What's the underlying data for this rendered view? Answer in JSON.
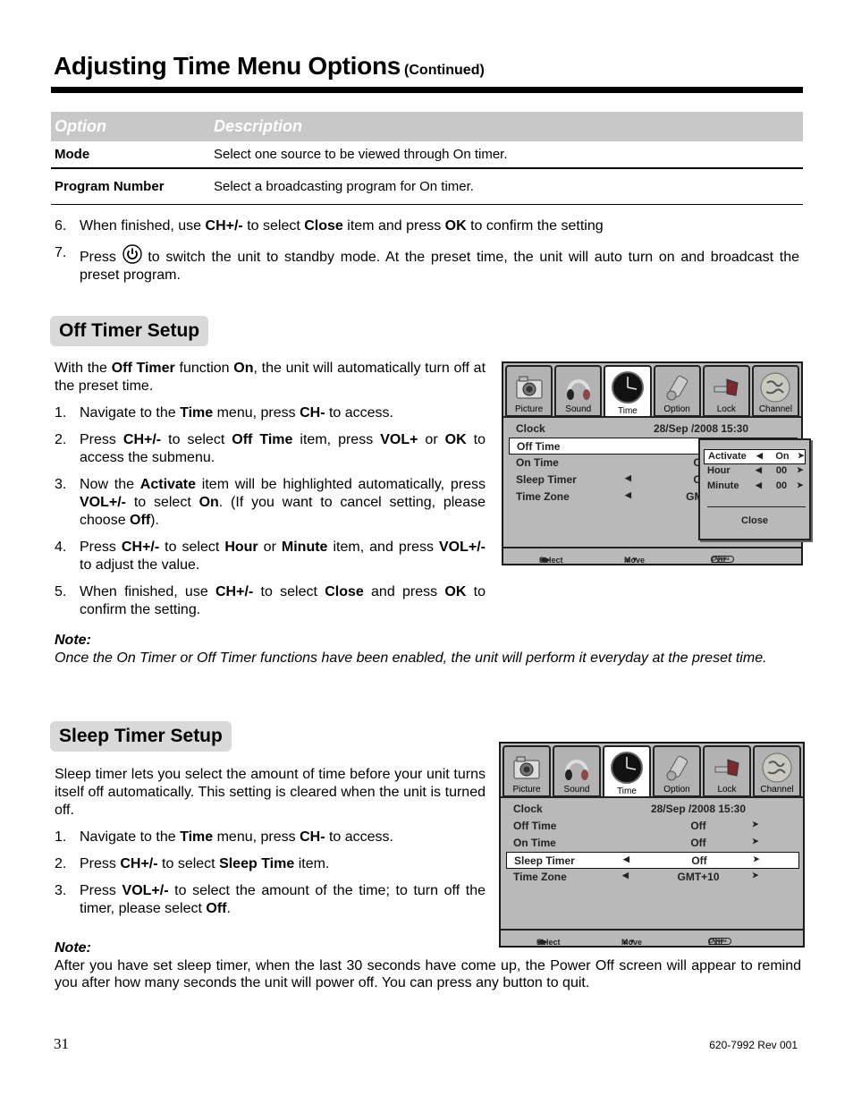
{
  "header": {
    "title": "Adjusting Time Menu Options",
    "subtitle": "(Continued)"
  },
  "table": {
    "headers": [
      "Option",
      "Description"
    ],
    "rows": [
      {
        "option": "Mode",
        "description": "Select one source to be viewed through On timer."
      },
      {
        "option": "Program Number",
        "description": "Select a broadcasting program for On timer."
      }
    ]
  },
  "continued_steps": [
    {
      "num": "6.",
      "parts": [
        "When finished, use ",
        "CH+/-",
        " to select ",
        "Close",
        " item and press ",
        "OK",
        " to confirm the setting"
      ]
    },
    {
      "num": "7.",
      "pre": "Press ",
      "icon": "power-icon",
      "post": " to switch the unit to standby mode. At the preset time, the unit will auto turn on and broadcast the preset program."
    }
  ],
  "off_timer": {
    "heading": "Off Timer Setup",
    "intro": [
      "With the ",
      "Off Timer",
      " function ",
      "On",
      ", the unit will automatically turn off at the preset time."
    ],
    "steps": [
      {
        "num": "1.",
        "parts": [
          "Navigate to the ",
          "Time",
          " menu, press ",
          "CH-",
          " to access."
        ]
      },
      {
        "num": "2.",
        "parts": [
          "Press ",
          "CH+/-",
          " to select ",
          "Off Time",
          " item, press ",
          "VOL+",
          " or ",
          "OK",
          " to access the submenu."
        ]
      },
      {
        "num": "3.",
        "parts": [
          "Now the ",
          "Activate",
          " item will be highlighted automatically, press ",
          "VOL+/-",
          " to select ",
          "On",
          ". (If you want to cancel setting, please choose ",
          "Off",
          ")."
        ]
      },
      {
        "num": "4.",
        "parts": [
          "Press ",
          "CH+/-",
          " to select ",
          "Hour",
          " or ",
          "Minute",
          " item, and press ",
          "VOL+/-",
          " to adjust the value."
        ]
      },
      {
        "num": "5.",
        "parts": [
          "When finished, use ",
          "CH+/-",
          " to select ",
          "Close",
          " and press ",
          "OK",
          " to confirm the setting."
        ]
      }
    ],
    "note_title": "Note:",
    "note_text": "Once the On Timer or Off Timer functions have been enabled, the unit will perform it everyday at the preset time."
  },
  "sleep_timer": {
    "heading": "Sleep Timer Setup",
    "intro": "Sleep timer lets you select the amount of time before your unit turns itself off automatically. This setting is cleared when the unit is turned off.",
    "steps": [
      {
        "num": "1.",
        "parts": [
          "Navigate to the ",
          "Time",
          " menu, press ",
          "CH-",
          " to access."
        ]
      },
      {
        "num": "2.",
        "parts": [
          "Press ",
          "CH+/-",
          " to select ",
          "Sleep Time",
          " item."
        ]
      },
      {
        "num": "3.",
        "parts": [
          "Press ",
          "VOL+/-",
          " to select the amount of the time; to turn off the timer, please select ",
          "Off",
          "."
        ]
      }
    ],
    "note_title": "Note:",
    "note_text": "After you have set sleep timer, when the last 30 seconds have come up, the Power Off screen will appear to remind you after how many seconds the unit will power off. You can press any button to quit."
  },
  "osd": {
    "tabs": [
      {
        "label": "Picture",
        "icon": "camera-icon"
      },
      {
        "label": "Sound",
        "icon": "headphones-icon"
      },
      {
        "label": "Time",
        "icon": "clock-icon",
        "active": true
      },
      {
        "label": "Option",
        "icon": "gear-icon"
      },
      {
        "label": "Lock",
        "icon": "lock-icon"
      },
      {
        "label": "Channel",
        "icon": "globe-icon"
      }
    ],
    "footer": {
      "select": "Select",
      "move": "Move",
      "menu_key": "Menu",
      "exit": "Exit"
    },
    "screen1": {
      "rows": [
        {
          "label": "Clock",
          "value": "28/Sep  /2008 15:30"
        },
        {
          "label": "Off Time",
          "value": "",
          "selected": true
        },
        {
          "label": "On Time",
          "value": "Off"
        },
        {
          "label": "Sleep Timer",
          "value": "Off",
          "left_arrow": true
        },
        {
          "label": "Time Zone",
          "value": "GMT+",
          "left_arrow": true
        }
      ],
      "submenu": {
        "rows": [
          {
            "label": "Activate",
            "value": "On",
            "selected": true
          },
          {
            "label": "Hour",
            "value": "00"
          },
          {
            "label": "Minute",
            "value": "00"
          }
        ],
        "close_label": "Close"
      }
    },
    "screen2": {
      "rows": [
        {
          "label": "Clock",
          "value": "28/Sep  /2008 15:30"
        },
        {
          "label": "Off Time",
          "value": "Off",
          "right_arrow": true
        },
        {
          "label": "On Time",
          "value": "Off",
          "right_arrow": true
        },
        {
          "label": "Sleep Timer",
          "value": "Off",
          "left_arrow": true,
          "right_arrow": true,
          "selected": true
        },
        {
          "label": "Time Zone",
          "value": "GMT+10",
          "left_arrow": true,
          "right_arrow": true
        }
      ]
    }
  },
  "page_footer": {
    "page_number": "31",
    "doc_revision": "620-7992 Rev 001"
  }
}
